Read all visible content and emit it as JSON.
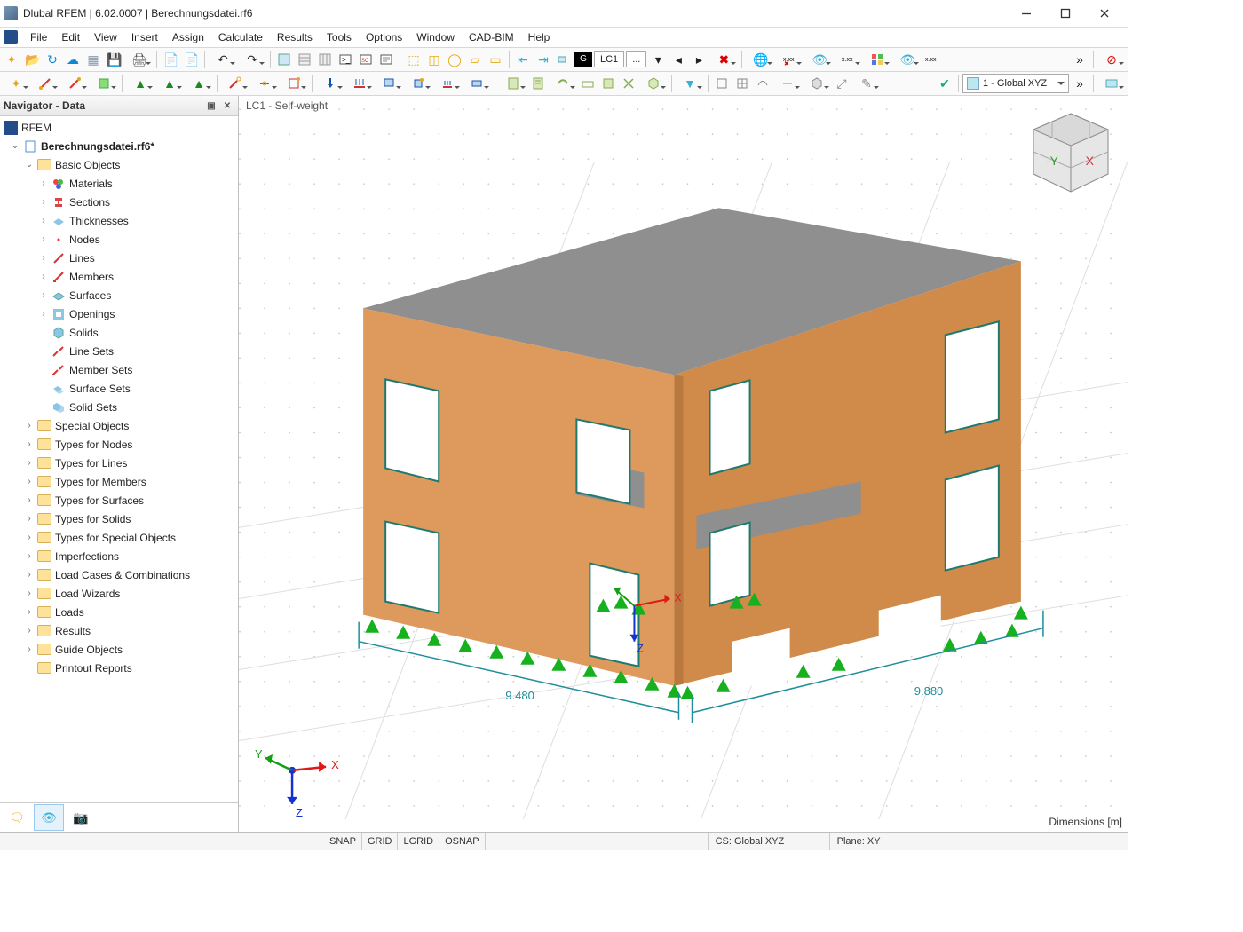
{
  "window": {
    "title": "Dlubal RFEM | 6.02.0007 | Berechnungsdatei.rf6"
  },
  "menu": {
    "items": [
      "File",
      "Edit",
      "View",
      "Insert",
      "Assign",
      "Calculate",
      "Results",
      "Tools",
      "Options",
      "Window",
      "CAD-BIM",
      "Help"
    ]
  },
  "loadcase": {
    "g": "G",
    "label": "LC1",
    "ellipsis": "...",
    "dropdown": "1 - Global XYZ"
  },
  "navigator": {
    "title": "Navigator - Data",
    "root": "RFEM",
    "file": "Berechnungsdatei.rf6*",
    "basic": {
      "label": "Basic Objects",
      "children": [
        "Materials",
        "Sections",
        "Thicknesses",
        "Nodes",
        "Lines",
        "Members",
        "Surfaces",
        "Openings",
        "Solids",
        "Line Sets",
        "Member Sets",
        "Surface Sets",
        "Solid Sets"
      ]
    },
    "groups": [
      "Special Objects",
      "Types for Nodes",
      "Types for Lines",
      "Types for Members",
      "Types for Surfaces",
      "Types for Solids",
      "Types for Special Objects",
      "Imperfections",
      "Load Cases & Combinations",
      "Load Wizards",
      "Loads",
      "Results",
      "Guide Objects",
      "Printout Reports"
    ]
  },
  "viewport": {
    "header": "LC1 - Self-weight",
    "dim_left": "9.480",
    "dim_right": "9.880",
    "axes": {
      "x": "X",
      "y": "Y",
      "z": "Z"
    },
    "cube": {
      "y": "-Y",
      "x": "-X"
    },
    "dimensions_note": "Dimensions [m]"
  },
  "status": {
    "toggles": [
      "SNAP",
      "GRID",
      "LGRID",
      "OSNAP"
    ],
    "cs": "CS: Global XYZ",
    "plane": "Plane: XY"
  }
}
